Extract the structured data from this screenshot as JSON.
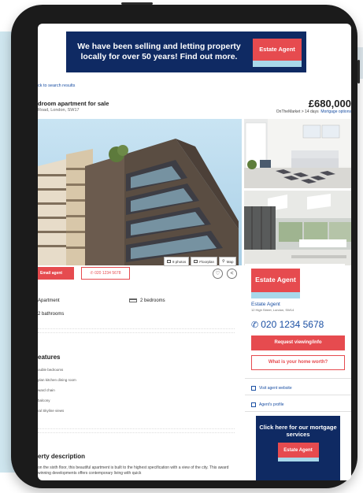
{
  "banner": {
    "text": "We have been selling and letting property locally for over 50 years! Find out more.",
    "logo": "Estate Agent"
  },
  "nav": {
    "back_link": "ck to search results"
  },
  "property": {
    "title": "droom apartment for sale",
    "address": "Road, London, SW17",
    "price": "£680,000",
    "listing_site": "OnTheMarket",
    "listed": "> 14 days",
    "mortgage_link": "Mortgage options"
  },
  "photo_tabs": {
    "photos": "8 photos",
    "floorplan": "Floorplan",
    "map": "Map"
  },
  "actions": {
    "email": "Email agent",
    "call": "020 1234 5678"
  },
  "key_features": {
    "type": "Apartment",
    "bedrooms": "2 bedrooms",
    "bathrooms": "2 bathrooms"
  },
  "features": {
    "heading": "eatures",
    "items": [
      "ouble bedrooms",
      "plan kitchen dining room",
      "ward chain",
      "balcony",
      "ral Skyline views"
    ]
  },
  "description": {
    "heading": "erty description",
    "text": "on the sixth floor, this beautiful apartment is built to the highest specification with a view of the city. This award winning developments offers contemporary living with quick"
  },
  "agent": {
    "logo": "Estate Agent",
    "name": "Estate Agent",
    "address": "12 High Street, London, SW14",
    "phone": "020 1234 5678",
    "request_btn": "Request viewing/info",
    "worth_btn": "What is your home worth?",
    "website_link": "Visit agent website",
    "profile_link": "Agent's profile"
  },
  "mortgage_ad": {
    "text": "Click here for our mortgage services",
    "logo": "Estate Agent"
  },
  "colors": {
    "brand_red": "#e64b4f",
    "navy": "#0f2a63",
    "link_blue": "#1a4fa3",
    "light_blue": "#a8d8ea"
  }
}
